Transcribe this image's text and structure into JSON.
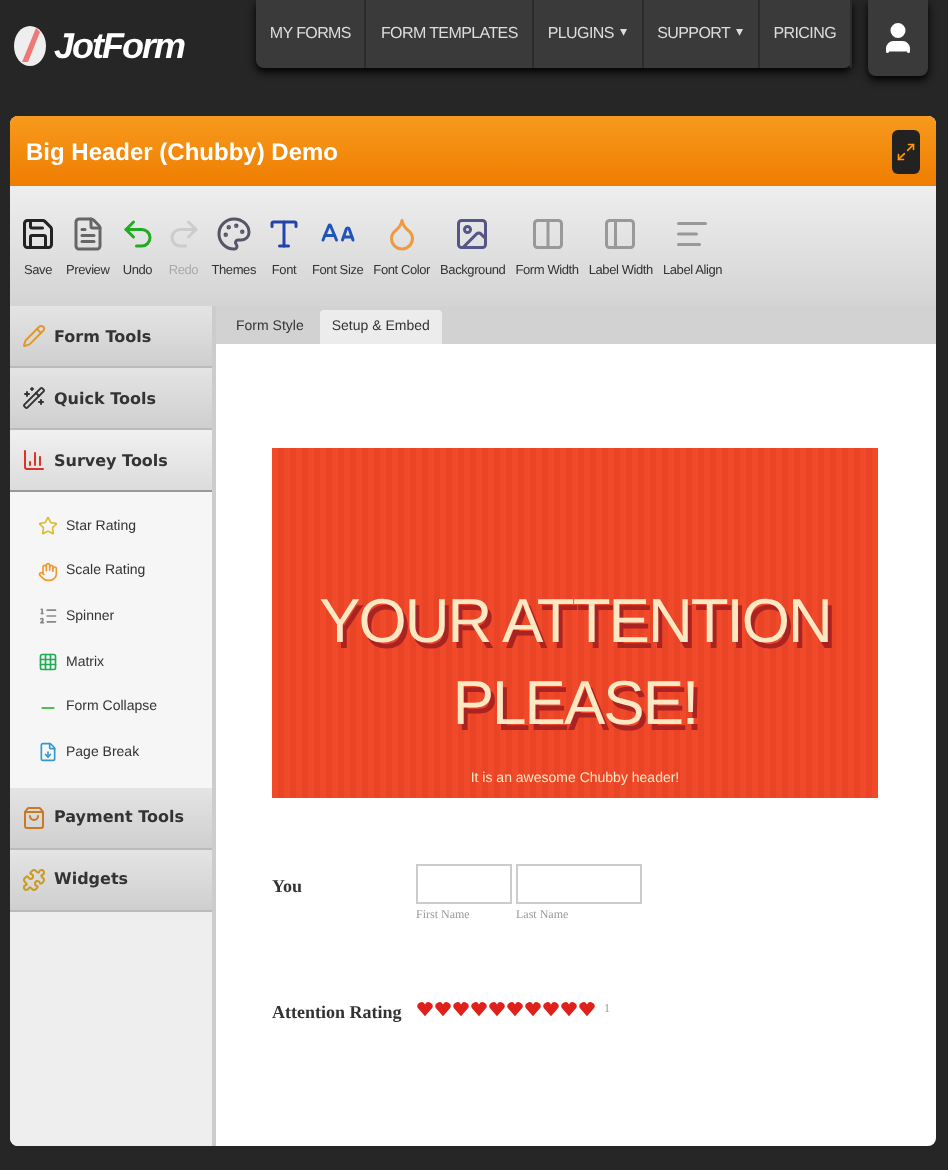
{
  "logo": {
    "text": "JotForm"
  },
  "nav": [
    {
      "label": "MY FORMS"
    },
    {
      "label": "FORM TEMPLATES"
    },
    {
      "label": "PLUGINS",
      "caret": "▾"
    },
    {
      "label": "SUPPORT",
      "caret": "▾"
    },
    {
      "label": "PRICING"
    }
  ],
  "window": {
    "title": "Big Header (Chubby) Demo"
  },
  "toolbar": [
    {
      "label": "Save",
      "disabled": false
    },
    {
      "label": "Preview",
      "disabled": false
    },
    {
      "label": "Undo",
      "disabled": false
    },
    {
      "label": "Redo",
      "disabled": true
    },
    {
      "label": "Themes",
      "disabled": false
    },
    {
      "label": "Font",
      "disabled": false
    },
    {
      "label": "Font Size",
      "disabled": false
    },
    {
      "label": "Font Color",
      "disabled": false
    },
    {
      "label": "Background",
      "disabled": false
    },
    {
      "label": "Form Width",
      "disabled": false
    },
    {
      "label": "Label Width",
      "disabled": false
    },
    {
      "label": "Label Align",
      "disabled": false
    }
  ],
  "sidebar": {
    "sections": [
      {
        "label": "Form Tools",
        "expanded": false
      },
      {
        "label": "Quick Tools",
        "expanded": false
      },
      {
        "label": "Survey Tools",
        "expanded": true,
        "items": [
          "Star Rating",
          "Scale Rating",
          "Spinner",
          "Matrix",
          "Form Collapse",
          "Page Break"
        ]
      },
      {
        "label": "Payment Tools",
        "expanded": false
      },
      {
        "label": "Widgets",
        "expanded": false
      }
    ]
  },
  "tabs": [
    {
      "label": "Form Style",
      "selected": false
    },
    {
      "label": "Setup & Embed",
      "selected": true
    }
  ],
  "form": {
    "header": {
      "title": "YOUR ATTENTION PLEASE!",
      "subtitle": "It is an awesome Chubby header!"
    },
    "name_field": {
      "label": "You",
      "first": "First Name",
      "last": "Last Name"
    },
    "rating": {
      "label": "Attention Rating",
      "stars": 10,
      "value": "1"
    }
  }
}
